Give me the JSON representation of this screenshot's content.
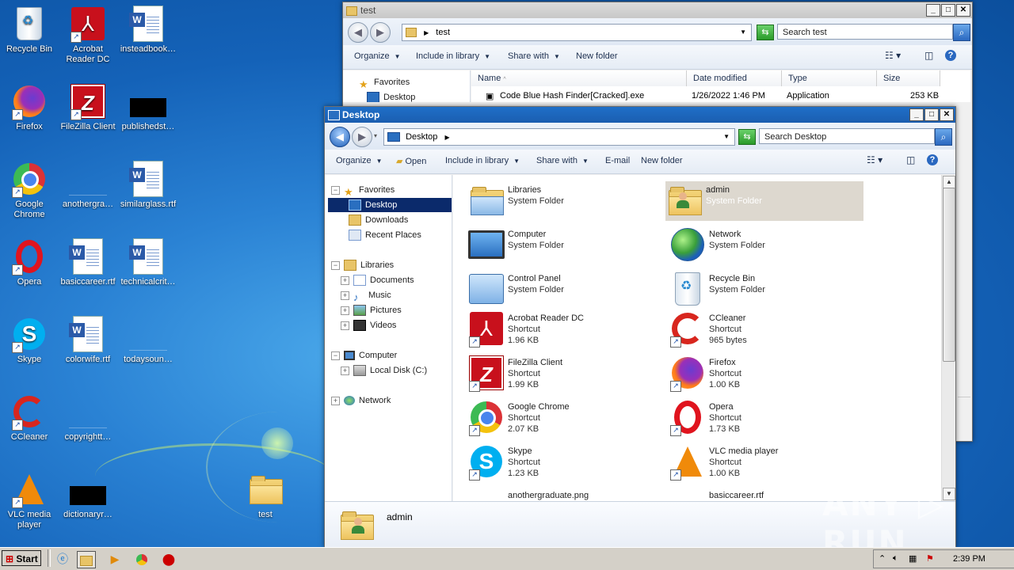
{
  "desktop_icons": [
    {
      "id": "recycle-bin",
      "label": "Recycle Bin"
    },
    {
      "id": "acrobat",
      "label": "Acrobat Reader DC"
    },
    {
      "id": "insteadbook",
      "label": "insteadbook…"
    },
    {
      "id": "firefox",
      "label": "Firefox"
    },
    {
      "id": "filezilla",
      "label": "FileZilla Client"
    },
    {
      "id": "publishedst",
      "label": "publishedst…"
    },
    {
      "id": "chrome",
      "label": "Google Chrome"
    },
    {
      "id": "anothergra",
      "label": "anothergra…"
    },
    {
      "id": "similarglass",
      "label": "similarglass.rtf"
    },
    {
      "id": "opera",
      "label": "Opera"
    },
    {
      "id": "basiccareer",
      "label": "basiccareer.rtf"
    },
    {
      "id": "technicalcrit",
      "label": "technicalcrit…"
    },
    {
      "id": "skype",
      "label": "Skype"
    },
    {
      "id": "colorwife",
      "label": "colorwife.rtf"
    },
    {
      "id": "todaysoun",
      "label": "todaysoun…"
    },
    {
      "id": "ccleaner",
      "label": "CCleaner"
    },
    {
      "id": "copyrightt",
      "label": "copyrightt…"
    },
    {
      "id": "vlc",
      "label": "VLC media player"
    },
    {
      "id": "dictionaryr",
      "label": "dictionaryr…"
    },
    {
      "id": "test",
      "label": "test"
    }
  ],
  "back_window": {
    "title": "test",
    "address": "test",
    "search_placeholder": "Search test",
    "toolbar": {
      "organize": "Organize",
      "include": "Include in library",
      "share": "Share with",
      "new_folder": "New folder"
    },
    "nav": {
      "favorites": "Favorites",
      "desktop": "Desktop"
    },
    "columns": {
      "name": "Name",
      "date": "Date modified",
      "type": "Type",
      "size": "Size"
    },
    "row": {
      "name": "Code Blue Hash Finder[Cracked].exe",
      "date": "1/26/2022 1:46 PM",
      "type": "Application",
      "size": "253 KB"
    }
  },
  "front_window": {
    "title": "Desktop",
    "address": "Desktop",
    "search_placeholder": "Search Desktop",
    "toolbar": {
      "organize": "Organize",
      "open": "Open",
      "include": "Include in library",
      "share": "Share with",
      "email": "E-mail",
      "new_folder": "New folder"
    },
    "nav": {
      "favorites": "Favorites",
      "desktop": "Desktop",
      "downloads": "Downloads",
      "recent": "Recent Places",
      "libraries": "Libraries",
      "documents": "Documents",
      "music": "Music",
      "pictures": "Pictures",
      "videos": "Videos",
      "computer": "Computer",
      "local_disk": "Local Disk (C:)",
      "network": "Network"
    },
    "items": [
      {
        "name": "Libraries",
        "line2": "System Folder",
        "line3": ""
      },
      {
        "name": "admin",
        "line2": "System Folder",
        "line3": ""
      },
      {
        "name": "Computer",
        "line2": "System Folder",
        "line3": ""
      },
      {
        "name": "Network",
        "line2": "System Folder",
        "line3": ""
      },
      {
        "name": "Control Panel",
        "line2": "System Folder",
        "line3": ""
      },
      {
        "name": "Recycle Bin",
        "line2": "System Folder",
        "line3": ""
      },
      {
        "name": "Acrobat Reader DC",
        "line2": "Shortcut",
        "line3": "1.96 KB"
      },
      {
        "name": "CCleaner",
        "line2": "Shortcut",
        "line3": "965 bytes"
      },
      {
        "name": "FileZilla Client",
        "line2": "Shortcut",
        "line3": "1.99 KB"
      },
      {
        "name": "Firefox",
        "line2": "Shortcut",
        "line3": "1.00 KB"
      },
      {
        "name": "Google Chrome",
        "line2": "Shortcut",
        "line3": "2.07 KB"
      },
      {
        "name": "Opera",
        "line2": "Shortcut",
        "line3": "1.73 KB"
      },
      {
        "name": "Skype",
        "line2": "Shortcut",
        "line3": "1.23 KB"
      },
      {
        "name": "VLC media player",
        "line2": "Shortcut",
        "line3": "1.00 KB"
      },
      {
        "name": "anothergraduate.png",
        "line2": "",
        "line3": ""
      },
      {
        "name": "basiccareer.rtf",
        "line2": "",
        "line3": ""
      }
    ],
    "details_name": "admin"
  },
  "taskbar": {
    "start": "Start",
    "time": "2:39 PM"
  },
  "watermark": "ANY ▷ RUN"
}
